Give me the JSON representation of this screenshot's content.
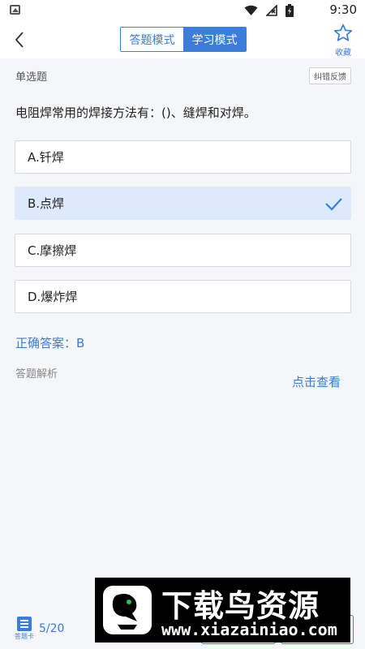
{
  "status_bar": {
    "time": "9:30"
  },
  "header": {
    "modes": [
      "答题模式",
      "学习模式"
    ],
    "active_mode": "学习模式",
    "favorite_label": "收藏"
  },
  "question": {
    "type": "单选题",
    "report_label": "纠错反馈",
    "text": "电阻焊常用的焊接方法有：()、缝焊和对焊。",
    "options": [
      {
        "label": "A.钎焊",
        "selected": false
      },
      {
        "label": "B.点焊",
        "selected": true
      },
      {
        "label": "C.摩擦焊",
        "selected": false
      },
      {
        "label": "D.爆炸焊",
        "selected": false
      }
    ],
    "answer": "正确答案：B",
    "analysis_label": "答题解析",
    "view_label": "点击查看"
  },
  "footer": {
    "card_label": "答题卡",
    "progress": "5/20"
  },
  "watermark": {
    "title": "下载鸟资源",
    "url": "www.xiazainiao.com"
  },
  "colors": {
    "accent": "#3b7ddd",
    "selected_bg": "#ddeafc",
    "page_bg": "#f5f6f8"
  }
}
